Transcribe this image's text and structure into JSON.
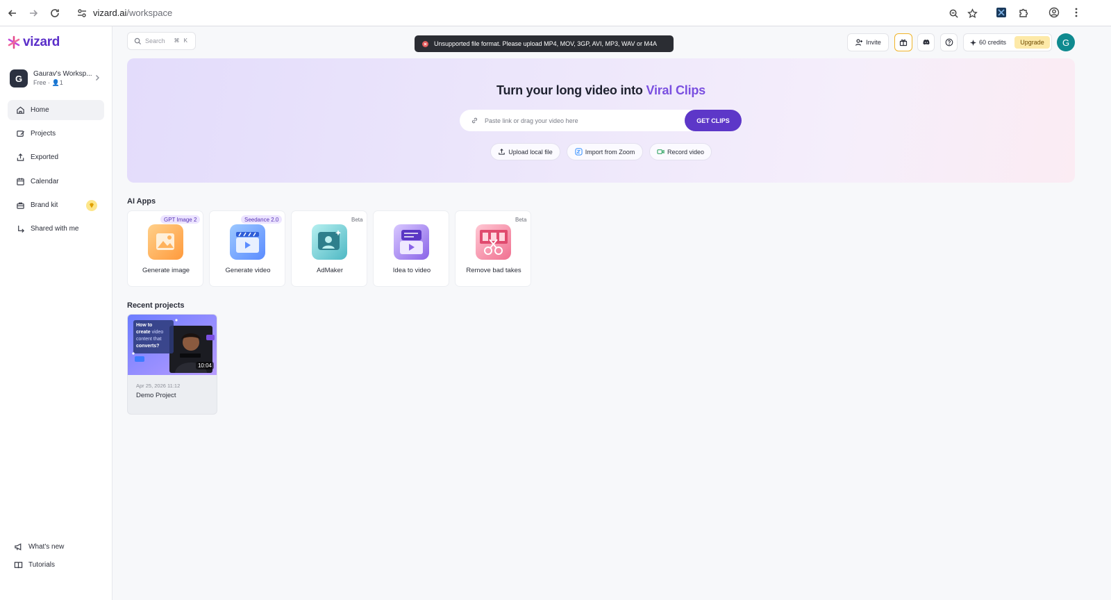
{
  "browser": {
    "url_host": "vizard.ai",
    "url_path": "/workspace"
  },
  "sidebar": {
    "logo_text": "vizard",
    "workspace": {
      "avatar_letter": "G",
      "name": "Gaurav's Worksp...",
      "plan": "Free · ",
      "members": "1"
    },
    "items": [
      {
        "label": "Home",
        "icon": "home-icon"
      },
      {
        "label": "Projects",
        "icon": "projects-icon"
      },
      {
        "label": "Exported",
        "icon": "export-icon"
      },
      {
        "label": "Calendar",
        "icon": "calendar-icon"
      },
      {
        "label": "Brand kit",
        "icon": "brand-kit-icon"
      },
      {
        "label": "Shared with me",
        "icon": "shared-icon"
      }
    ],
    "bottom": [
      {
        "label": "What's new",
        "icon": "megaphone-icon"
      },
      {
        "label": "Tutorials",
        "icon": "book-icon"
      }
    ]
  },
  "topbar": {
    "search_placeholder": "Search",
    "search_shortcut": "⌘ K",
    "toast": "Unsupported file format. Please upload MP4, MOV, 3GP, AVI, MP3, WAV or M4A",
    "invite_label": "Invite",
    "credits": "60 credits",
    "upgrade_label": "Upgrade",
    "avatar_letter": "G"
  },
  "hero": {
    "title_prefix": "Turn your long video into ",
    "title_accent": "Viral Clips",
    "input_placeholder": "Paste link or drag your video here",
    "cta_label": "GET CLIPS",
    "actions": [
      {
        "label": "Upload local file"
      },
      {
        "label": "Import from Zoom"
      },
      {
        "label": "Record video"
      }
    ]
  },
  "ai_apps": {
    "title": "AI Apps",
    "apps": [
      {
        "label": "Generate image",
        "tag": "GPT Image 2"
      },
      {
        "label": "Generate video",
        "tag": "Seedance 2.0"
      },
      {
        "label": "AdMaker",
        "tag": "Beta"
      },
      {
        "label": "Idea to video",
        "tag": ""
      },
      {
        "label": "Remove bad takes",
        "tag": "Beta"
      }
    ]
  },
  "recent": {
    "title": "Recent projects",
    "projects": [
      {
        "name": "Demo Project",
        "date": "Apr 25, 2026 11:12",
        "duration": "10:04",
        "thumb_line1": "How to",
        "thumb_line2": "create",
        "thumb_line2b": " video",
        "thumb_line3": "content that",
        "thumb_line4": "converts?"
      }
    ]
  },
  "colors": {
    "brand": "#5b2fc9",
    "cta": "#5d37c8",
    "accent_text": "#7a4fe0",
    "upgrade_bg": "#fde9a8",
    "avatar": "#0f8a8f"
  }
}
